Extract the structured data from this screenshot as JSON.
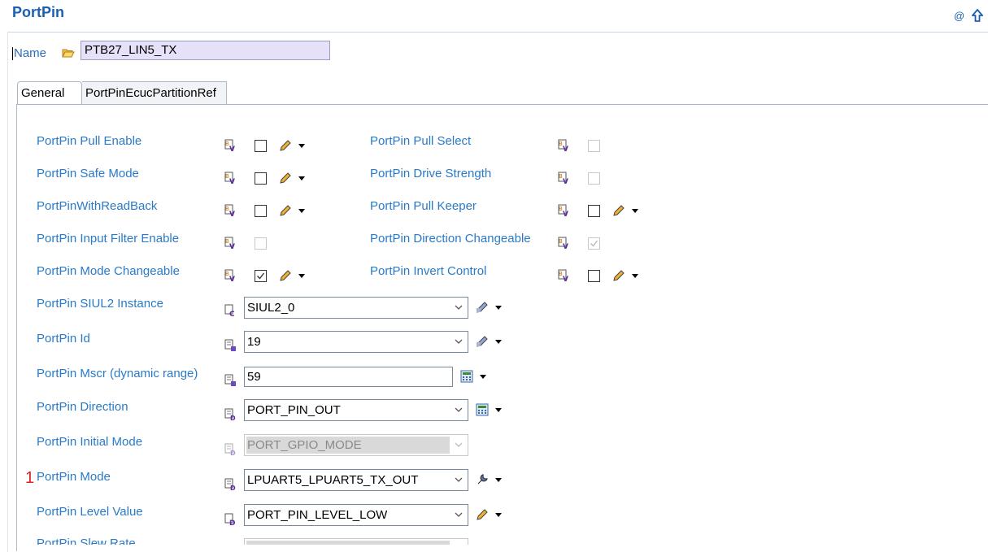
{
  "header": {
    "title": "PortPin"
  },
  "name_row": {
    "label": "Name",
    "value": "PTB27_LIN5_TX"
  },
  "tabs": [
    {
      "label": "General",
      "active": true
    },
    {
      "label": "PortPinEcucPartitionRef",
      "active": false
    }
  ],
  "bool_params": [
    {
      "label": "PortPin Pull Enable",
      "checked": false,
      "enabled": true
    },
    {
      "label": "PortPin Safe Mode",
      "checked": false,
      "enabled": true
    },
    {
      "label": "PortPinWithReadBack",
      "checked": false,
      "enabled": true
    },
    {
      "label": "PortPin Input Filter Enable",
      "checked": false,
      "enabled": false
    },
    {
      "label": "PortPin Mode Changeable",
      "checked": true,
      "enabled": true
    },
    {
      "label": "PortPin Pull Select",
      "checked": false,
      "enabled": false
    },
    {
      "label": "PortPin Drive Strength",
      "checked": false,
      "enabled": false
    },
    {
      "label": "PortPin Pull Keeper",
      "checked": false,
      "enabled": true
    },
    {
      "label": "PortPin Direction Changeable",
      "checked": true,
      "enabled": false
    },
    {
      "label": "PortPin Invert Control",
      "checked": false,
      "enabled": true
    }
  ],
  "value_params": [
    {
      "label": "PortPin SIUL2 Instance",
      "value": "SIUL2_0"
    },
    {
      "label": "PortPin Id",
      "value": "19"
    },
    {
      "label": "PortPin Mscr (dynamic range)",
      "value": "59"
    },
    {
      "label": "PortPin Direction",
      "value": "PORT_PIN_OUT"
    },
    {
      "label": "PortPin Initial Mode",
      "value": "PORT_GPIO_MODE",
      "enabled": false
    },
    {
      "label": "PortPin Mode",
      "value": "LPUART5_LPUART5_TX_OUT"
    },
    {
      "label": "PortPin Level Value",
      "value": "PORT_PIN_LEVEL_LOW"
    },
    {
      "label": "PortPin Slew Rate",
      "value": ""
    }
  ],
  "marker": "1",
  "colors": {
    "accent": "#1a5fb4",
    "label": "#2a7ac8",
    "name_field_bg": "#e6e0f8",
    "marker": "#e02020"
  }
}
